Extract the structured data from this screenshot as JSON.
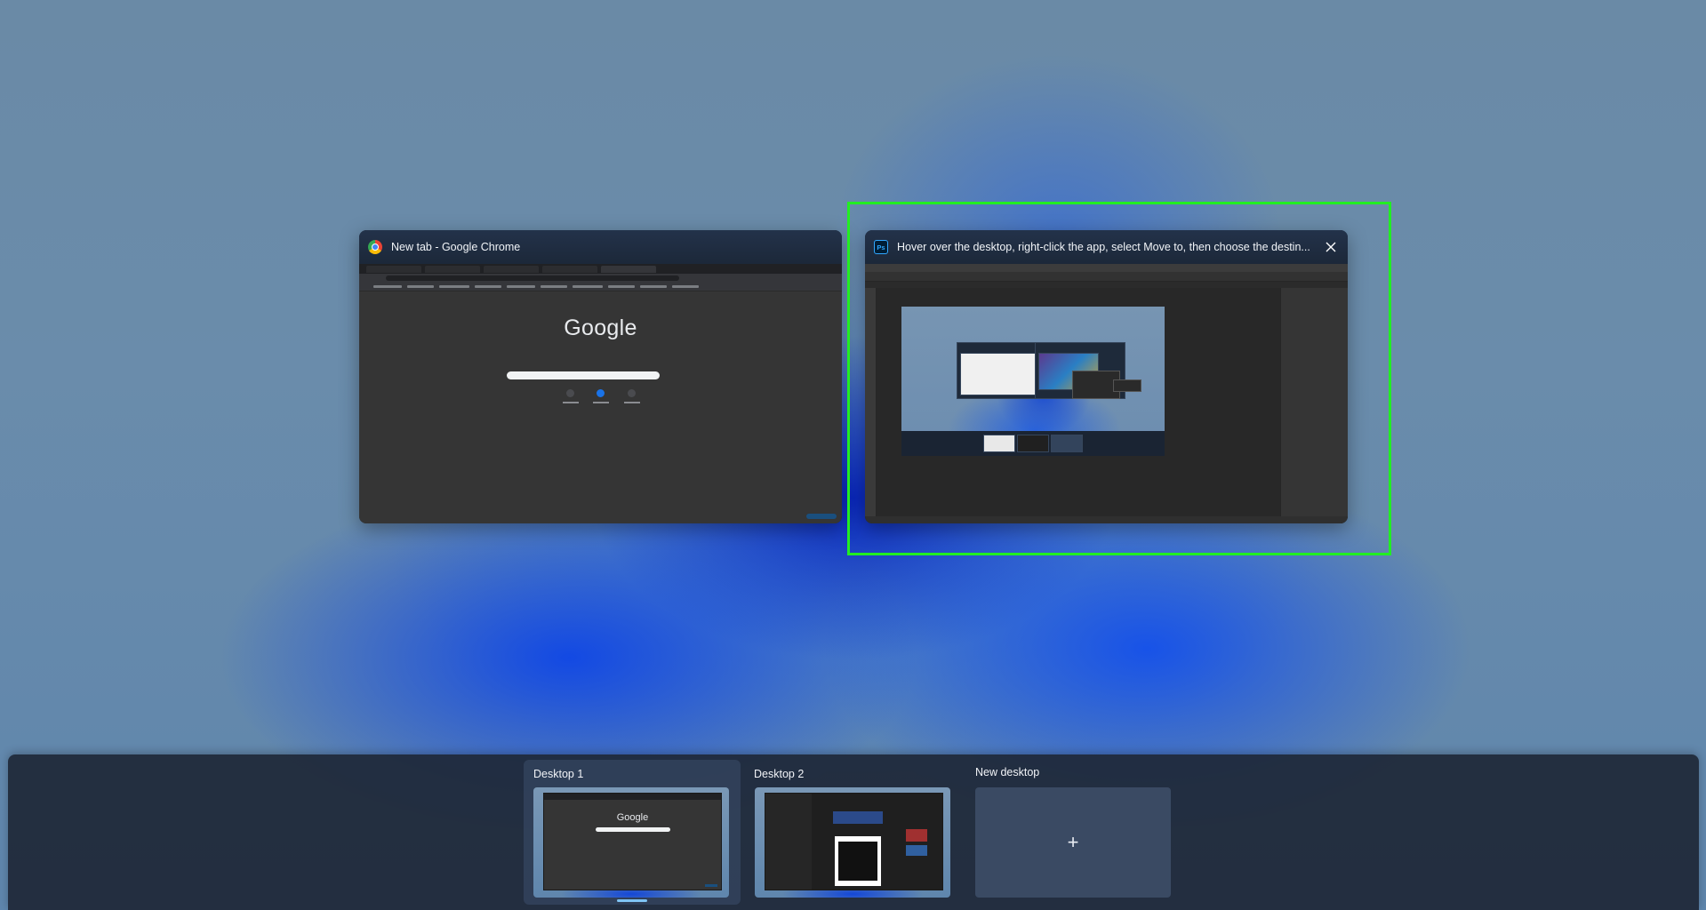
{
  "task_view": {
    "windows": [
      {
        "app": "Google Chrome",
        "icon": "chrome-icon",
        "title": "New tab - Google Chrome",
        "thumbnail": {
          "logo_text": "Google"
        }
      },
      {
        "app": "Adobe Photoshop",
        "icon": "photoshop-icon",
        "icon_text": "Ps",
        "title": "Hover over the desktop, right-click the app, select Move to, then choose the destin...",
        "close_label": "✕",
        "selected": true
      }
    ],
    "selection_highlight_color": "#22ee22"
  },
  "desktops": {
    "items": [
      {
        "label": "Desktop 1",
        "active": true,
        "thumb_logo_text": "Google"
      },
      {
        "label": "Desktop 2",
        "active": false
      }
    ],
    "new_desktop": {
      "label": "New desktop",
      "plus": "+"
    },
    "accent": "#7fc4f4"
  }
}
